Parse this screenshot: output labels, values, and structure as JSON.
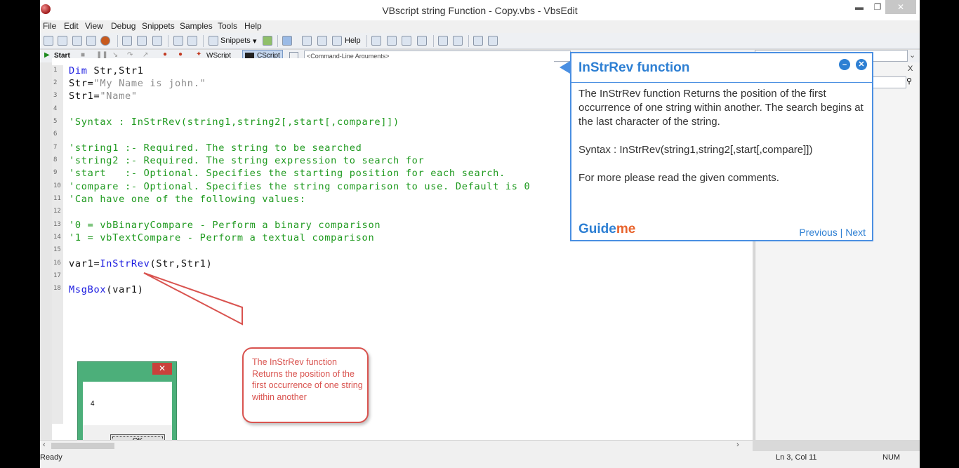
{
  "window": {
    "title": "VBscript string Function - Copy.vbs - VbsEdit",
    "minimize": "▬",
    "maximize": "❐",
    "close": "✕"
  },
  "menu": [
    "File",
    "Edit",
    "View",
    "Debug",
    "Snippets",
    "Samples",
    "Tools",
    "Help"
  ],
  "toolbar": {
    "snippets_label": "Snippets",
    "help_label": "Help",
    "start_label": "Start",
    "wscript_label": "WScript",
    "cscript_label": "CScript",
    "cmdline_placeholder": "<Command-Line Arguments>"
  },
  "code": {
    "line_numbers": [
      "1",
      "2",
      "3",
      "4",
      "5",
      "6",
      "7",
      "8",
      "9",
      "10",
      "11",
      "12",
      "13",
      "14",
      "15",
      "16",
      "17",
      "18"
    ],
    "l1_kw": "Dim",
    "l1_rest": " Str,Str1",
    "l2_var": "Str=",
    "l2_str": "\"My Name is john.\"",
    "l3_var": "Str1=",
    "l3_str": "\"Name\"",
    "l5": "'Syntax : InStrRev(string1,string2[,start[,compare]])",
    "l7": "'string1 :- Required. The string to be searched",
    "l8": "'string2 :- Required. The string expression to search for",
    "l9": "'start   :- Optional. Specifies the starting position for each search.",
    "l10": "'compare :- Optional. Specifies the string comparison to use. Default is 0",
    "l11": "'Can have one of the following values:",
    "l13": "'0 = vbBinaryCompare - Perform a binary comparison",
    "l14": "'1 = vbTextCompare - Perform a textual comparison",
    "l16_var": "var1=",
    "l16_fn": "InStrRev",
    "l16_rest": "(Str,Str1)",
    "l18_fn": "MsgBox",
    "l18_rest": "(var1)"
  },
  "msgbox": {
    "close": "✕",
    "value": "4",
    "ok_label": "OK"
  },
  "callout": {
    "text": "The InStrRev function Returns the position of the first occurrence of one string within another"
  },
  "guide": {
    "title": "InStrRev function",
    "minimize": "–",
    "close": "✕",
    "para1": "The InStrRev function Returns the position of the first occurrence of one string within another. The search begins at the last character of the string.",
    "para2": "Syntax : InStrRev(string1,string2[,start[,compare]])",
    "para3": "For more please read the given comments.",
    "logo_guide": "Guide",
    "logo_me": "me",
    "prev": "Previous",
    "sep": " | ",
    "next": "Next"
  },
  "status": {
    "left": "Ready",
    "position": "Ln 3, Col 11",
    "num": "NUM"
  }
}
